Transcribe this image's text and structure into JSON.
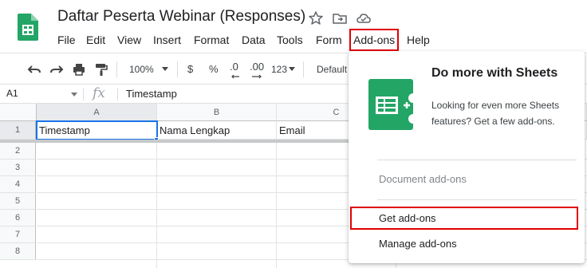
{
  "app": {
    "doc_title": "Daftar Peserta Webinar (Responses)",
    "icons": [
      "star-icon",
      "move-to-folder-icon",
      "cloud-saved-icon"
    ]
  },
  "menubar": {
    "items": [
      "File",
      "Edit",
      "View",
      "Insert",
      "Format",
      "Data",
      "Tools",
      "Form",
      "Add-ons",
      "Help"
    ],
    "highlighted": "Add-ons"
  },
  "toolbar": {
    "zoom": "100%",
    "currency": "$",
    "percent": "%",
    "decrease_decimal": ".0",
    "increase_decimal": ".00",
    "more_formats": "123",
    "font": "Default"
  },
  "formula_bar": {
    "name_box": "A1",
    "fx": "fx",
    "value": "Timestamp"
  },
  "sheet": {
    "columns": [
      "A",
      "B",
      "C"
    ],
    "rows": [
      "1",
      "2",
      "3",
      "4",
      "5",
      "6",
      "7",
      "8"
    ],
    "row1": [
      "Timestamp",
      "Nama Lengkap",
      "Email"
    ]
  },
  "addons_menu": {
    "promo_title": "Do more with Sheets",
    "promo_desc": "Looking for even more Sheets features? Get a few add-ons.",
    "document_addons": "Document add-ons",
    "get_addons": "Get add-ons",
    "manage_addons": "Manage add-ons"
  },
  "colors": {
    "sheets_green": "#23a566",
    "highlight_red": "#e00000",
    "selection_blue": "#1a73e8"
  }
}
